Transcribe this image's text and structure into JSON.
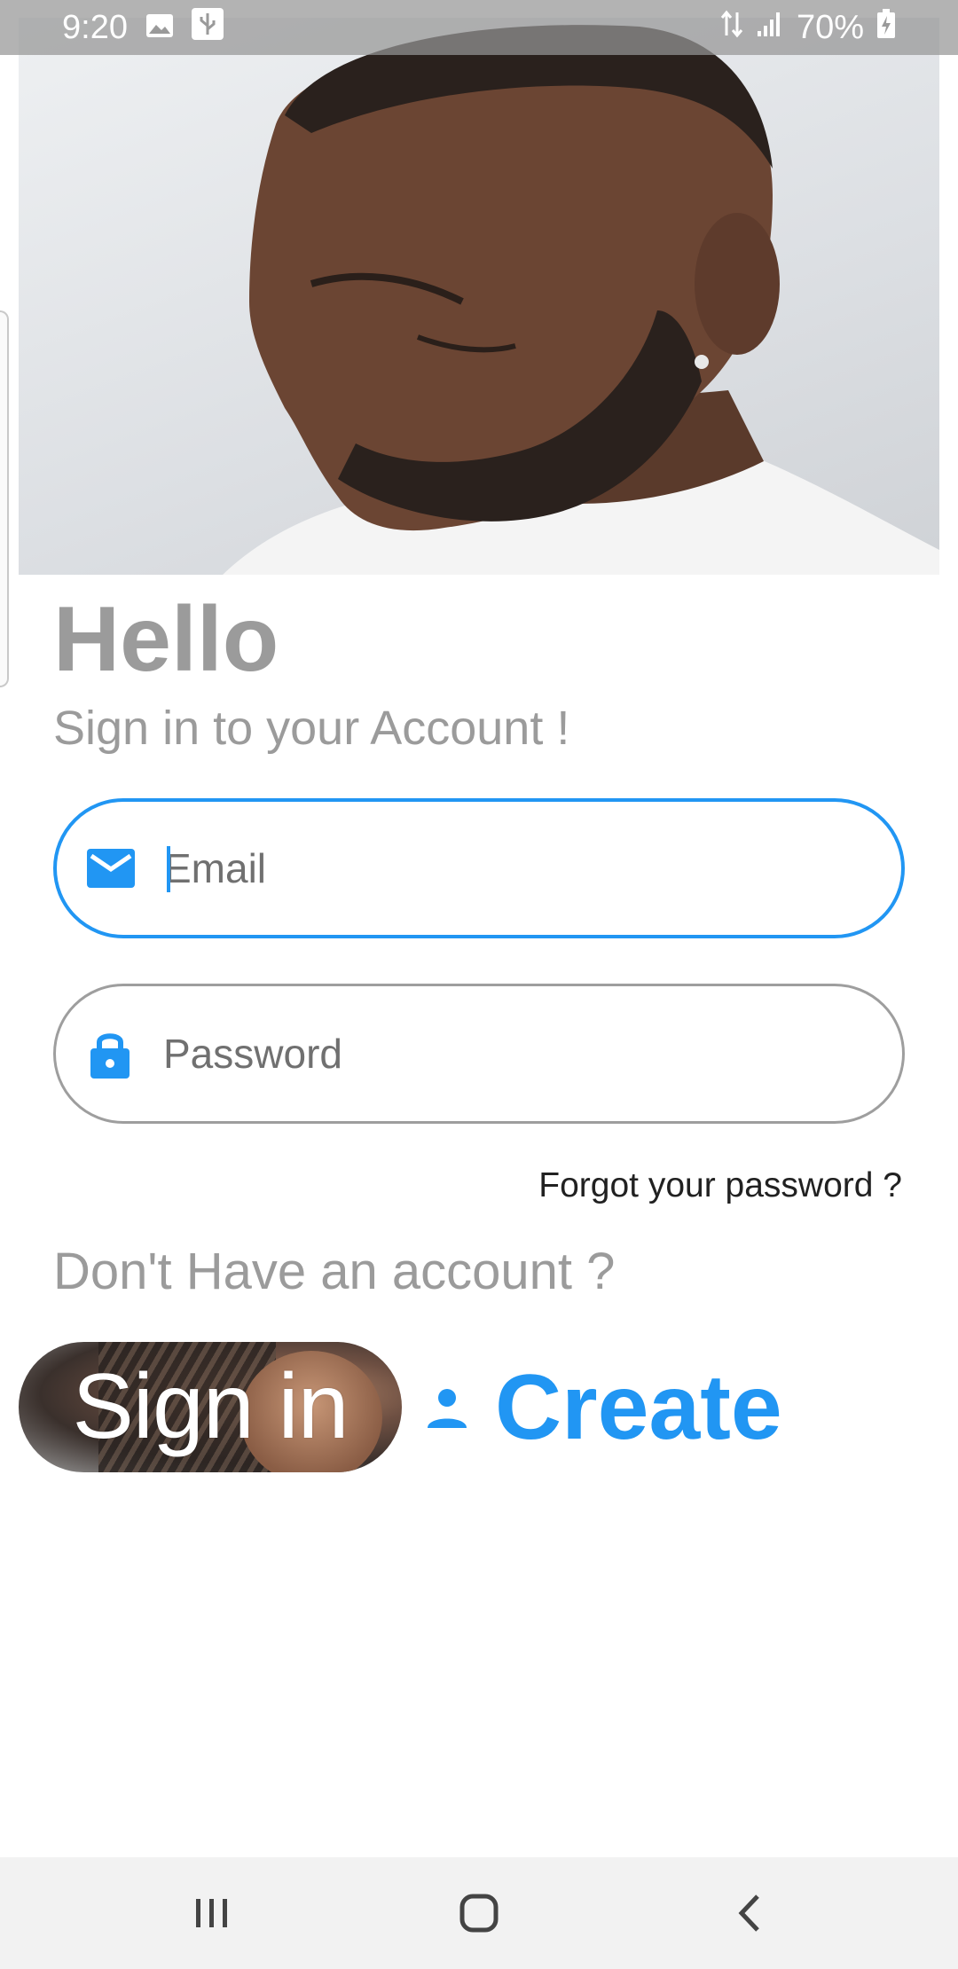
{
  "status_bar": {
    "time": "9:20",
    "battery": "70%",
    "icons": [
      "gallery-icon",
      "usb-icon",
      "data-arrows-icon",
      "signal-icon",
      "battery-charging-icon"
    ]
  },
  "hero": {
    "image": "man-with-beard-photo"
  },
  "login": {
    "title": "Hello",
    "subtitle": "Sign in to your Account !",
    "email_placeholder": "Email",
    "password_placeholder": "Password",
    "forgot": "Forgot your password ?",
    "no_account": "Don't Have an account ?",
    "signin_label": "Sign in",
    "create_label": "Create"
  },
  "colors": {
    "accent": "#2196f3",
    "muted_text": "#9b9b9b",
    "border": "#9e9e9e"
  },
  "navbar": {
    "icons": [
      "recents-icon",
      "home-icon",
      "back-icon"
    ]
  }
}
